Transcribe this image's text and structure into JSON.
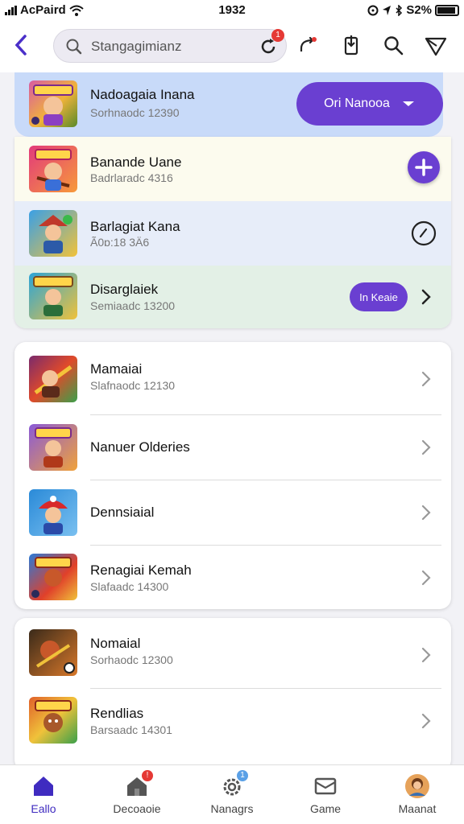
{
  "status_bar": {
    "carrier": "AcPaird",
    "time": "1932",
    "battery": "S2%"
  },
  "search": {
    "text": "Stangagimianz",
    "badge": "1"
  },
  "featured": {
    "title": "Nadoagaia Inana",
    "subtitle": "Sorhnaodc 12390",
    "button_label": "Ori Nanooa",
    "colors": {
      "card": "#c8daf9",
      "button": "#6a3fd1"
    }
  },
  "group1": [
    {
      "title": "Banande Uane",
      "subtitle": "Badrlaradc 4316",
      "action": "plus-circle-icon"
    },
    {
      "title": "Barlagiat Kana",
      "subtitle": "Ã0ɒ:18 3Ä6",
      "action": "clock-circle-icon"
    },
    {
      "title": "Disarglaiek",
      "subtitle": "Semiaadc 13200",
      "action_label": "In Keaie"
    }
  ],
  "group2": [
    {
      "title": "Mamaiai",
      "subtitle": "Slafnaodc 12130"
    },
    {
      "title": "Nanuer Olderies",
      "subtitle": ""
    },
    {
      "title": "Dennsiaial",
      "subtitle": ""
    },
    {
      "title": "Renagiai Kemah",
      "subtitle": "Slafaadc 14300"
    }
  ],
  "group3": [
    {
      "title": "Nomaial",
      "subtitle": "Sorhaodc 12300"
    },
    {
      "title": "Rendlias",
      "subtitle": "Barsaadc 14301"
    }
  ],
  "tabs": [
    {
      "label": "Eallo",
      "active": true
    },
    {
      "label": "Decoaoie",
      "badge": "!"
    },
    {
      "label": "Nanagrs",
      "badge": "1"
    },
    {
      "label": "Game"
    },
    {
      "label": "Maanat"
    }
  ]
}
